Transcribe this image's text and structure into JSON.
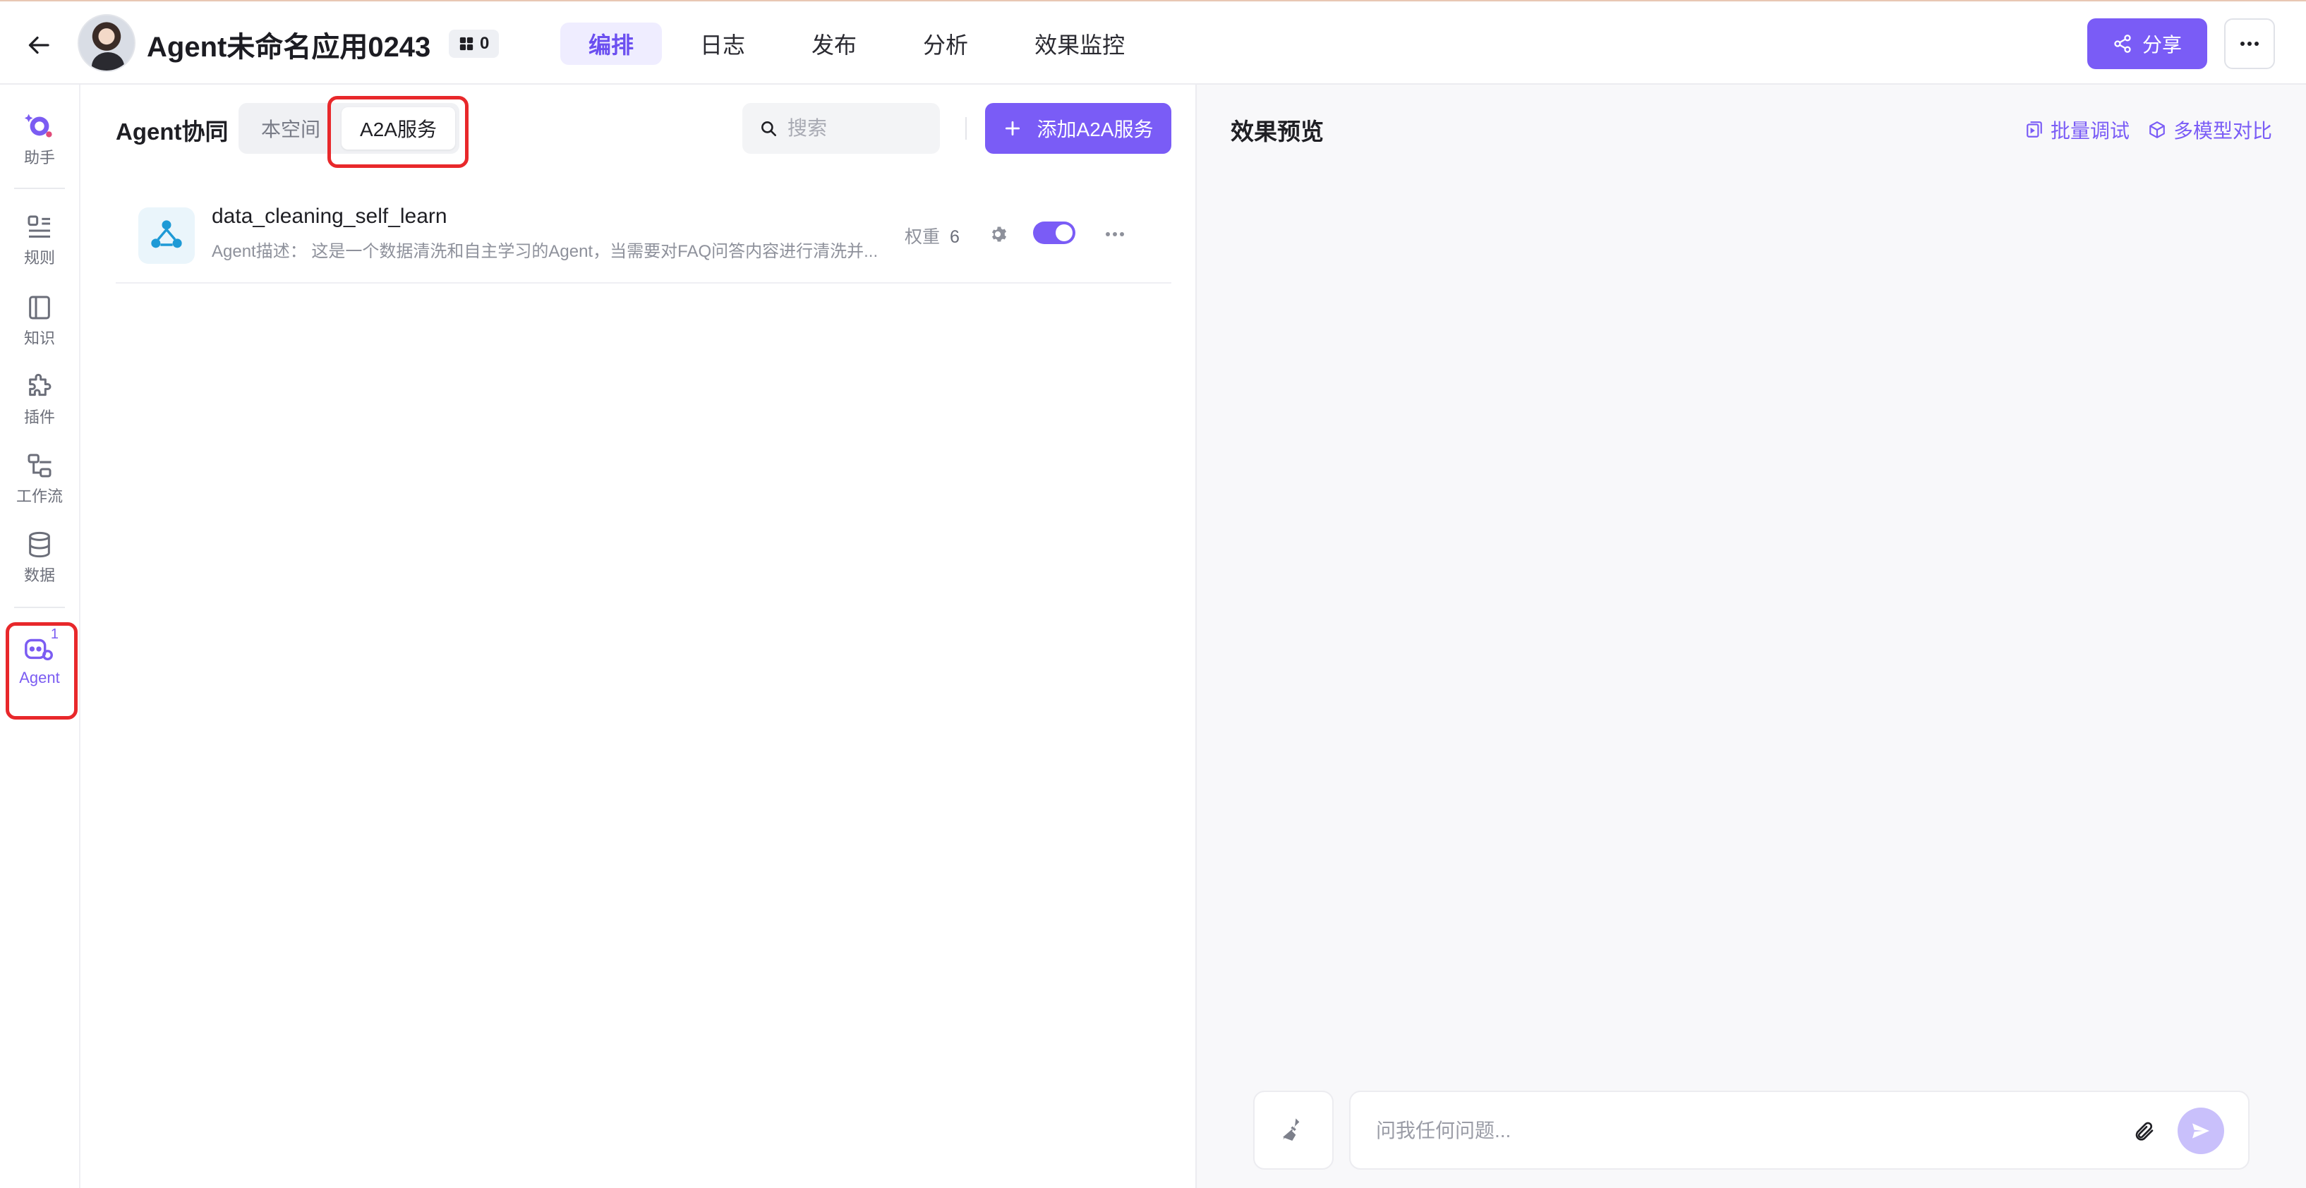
{
  "header": {
    "app_title": "Agent未命名应用0243",
    "badge_count": "0",
    "nav_tabs": [
      {
        "label": "编排",
        "active": true
      },
      {
        "label": "日志",
        "active": false
      },
      {
        "label": "发布",
        "active": false
      },
      {
        "label": "分析",
        "active": false
      },
      {
        "label": "效果监控",
        "active": false
      }
    ],
    "share_label": "分享",
    "accent_color": "#7a5cf6"
  },
  "rail": {
    "items": [
      {
        "label": "助手",
        "icon": "assistant-icon"
      },
      {
        "label": "规则",
        "icon": "rules-icon"
      },
      {
        "label": "知识",
        "icon": "book-icon"
      },
      {
        "label": "插件",
        "icon": "puzzle-icon"
      },
      {
        "label": "工作流",
        "icon": "workflow-icon"
      },
      {
        "label": "数据",
        "icon": "database-icon"
      },
      {
        "label": "Agent",
        "icon": "agent-icon",
        "active": true,
        "badge": "1"
      }
    ]
  },
  "main": {
    "title": "Agent协同",
    "segments": [
      {
        "label": "本空间",
        "active": false
      },
      {
        "label": "A2A服务",
        "active": true
      }
    ],
    "search_placeholder": "搜索",
    "add_button_label": "添加A2A服务",
    "rows": [
      {
        "name": "data_cleaning_self_learn",
        "description": "Agent描述：  这是一个数据清洗和自主学习的Agent，当需要对FAQ问答内容进行清洗并...",
        "weight_label": "权重",
        "weight_value": "6",
        "enabled": true
      }
    ]
  },
  "preview": {
    "title": "效果预览",
    "batch_debug_label": "批量调试",
    "multi_model_label": "多模型对比",
    "chat_placeholder": "问我任何问题..."
  }
}
